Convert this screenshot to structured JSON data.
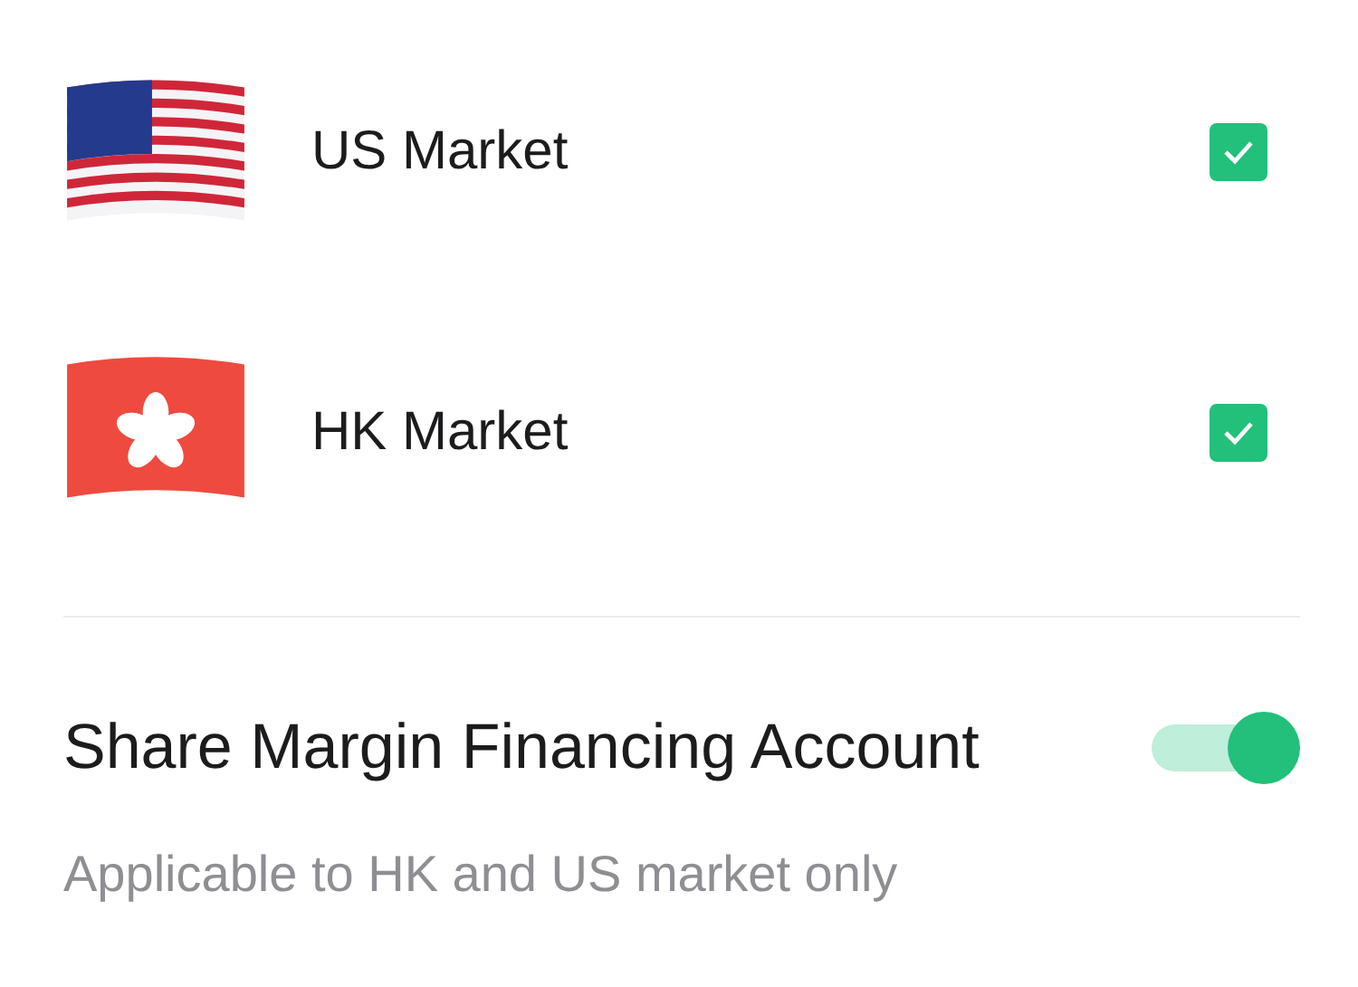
{
  "markets": [
    {
      "kind": "us",
      "name": "US Market",
      "checked": true
    },
    {
      "kind": "hk",
      "name": "HK Market",
      "checked": true
    }
  ],
  "margin_setting": {
    "title": "Share Margin Financing Account",
    "on": true,
    "note": "Applicable to HK and US market only"
  }
}
